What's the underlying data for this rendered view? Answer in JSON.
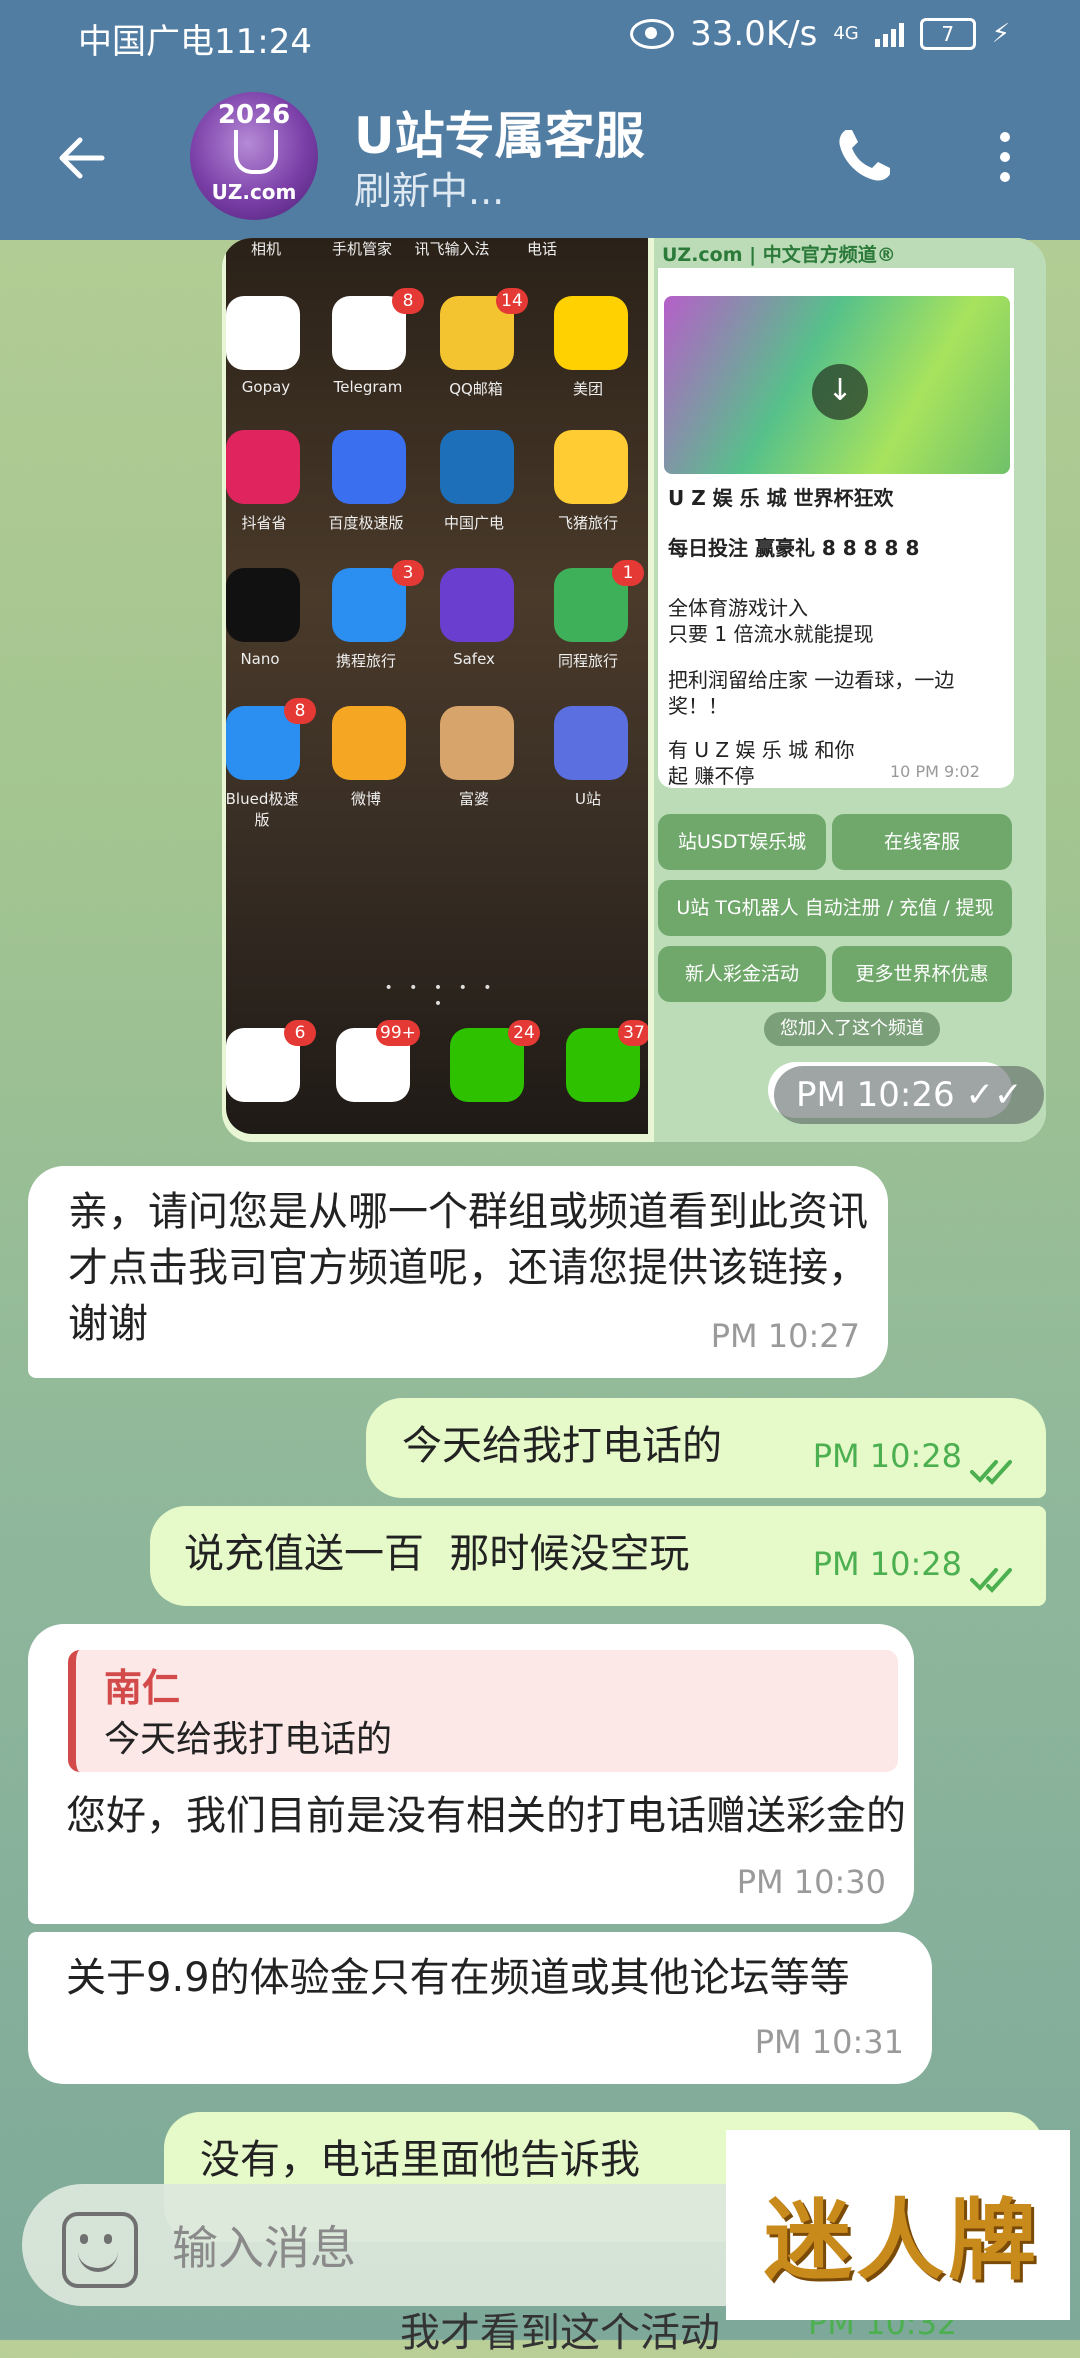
{
  "status_bar": {
    "carrier_time": "中国广电11:24",
    "speed": "33.0K/s",
    "network": "4G",
    "battery": "7"
  },
  "header": {
    "title": "U站专属客服",
    "subtitle": "刷新中...",
    "avatar_year": "2026",
    "avatar_domain": "UZ.com"
  },
  "screenshot": {
    "top_labels": [
      "相机",
      "手机管家",
      "讯飞输入法",
      "电话"
    ],
    "apps": [
      {
        "label": "Gopay",
        "badge": ""
      },
      {
        "label": "Telegram",
        "badge": "8"
      },
      {
        "label": "QQ邮箱",
        "badge": "14"
      },
      {
        "label": "美团",
        "badge": ""
      },
      {
        "label": "抖省省",
        "badge": ""
      },
      {
        "label": "百度极速版",
        "badge": ""
      },
      {
        "label": "中国广电",
        "badge": ""
      },
      {
        "label": "飞猪旅行",
        "badge": ""
      },
      {
        "label": "Nano",
        "badge": ""
      },
      {
        "label": "携程旅行",
        "badge": "3"
      },
      {
        "label": "Safex",
        "badge": ""
      },
      {
        "label": "同程旅行",
        "badge": "1"
      },
      {
        "label": "Blued极速版",
        "badge": "8"
      },
      {
        "label": "微博",
        "badge": ""
      },
      {
        "label": "富婆",
        "badge": ""
      },
      {
        "label": "U站",
        "badge": ""
      }
    ],
    "dock_badges": [
      "6",
      "99+",
      "24",
      "37"
    ],
    "page_dots": "• • • • • •",
    "channel": {
      "header": "UZ.com | 中文官方频道®",
      "lines": [
        "U Z 娱 乐 城  世界杯狂欢",
        "每日投注 赢豪礼 8 8 8 8 8",
        "全体育游戏计入",
        "只要 1 倍流水就能提现",
        "把利润留给庄家  一边看球，一边",
        "奖！！",
        "有 U Z 娱 乐 城 和你",
        "起 赚不停"
      ],
      "views_time": "10  PM 9:02",
      "buttons": [
        "站USDT娱乐城",
        "在线客服",
        "U站 TG机器人 自动注册 / 充值 / 提现",
        "新人彩金活动",
        "更多世界杯优惠"
      ],
      "joined": "您加入了这个频道"
    },
    "time": "PM 10:26"
  },
  "messages": [
    {
      "dir": "in",
      "text": "亲，请问您是从哪一个群组或频道看到此资讯才点击我司官方频道呢，还请您提供该链接，谢谢",
      "time": "PM 10:27"
    },
    {
      "dir": "out",
      "text": "今天给我打电话的",
      "time": "PM 10:28"
    },
    {
      "dir": "out",
      "text": "说充值送一百  那时候没空玩",
      "time": "PM 10:28"
    },
    {
      "dir": "in",
      "reply_name": "南仁",
      "reply_text": "今天给我打电话的",
      "text": "您好，我们目前是没有相关的打电话赠送彩金的",
      "time": "PM 10:30"
    },
    {
      "dir": "in",
      "text": "关于9.9的体验金只有在频道或其他论坛等等",
      "time": "PM 10:31"
    },
    {
      "dir": "out",
      "text": "没有，电话里面他告诉我",
      "time": ""
    }
  ],
  "partial_bottom": {
    "text": "我才看到这个活动",
    "time": "PM 10:32"
  },
  "input": {
    "placeholder": "输入消息"
  },
  "watermark": "迷人牌",
  "colors": {
    "header": "#527da3",
    "incoming": "#ffffff",
    "outgoing": "#e6f9c9",
    "time_out": "#4caf50"
  }
}
